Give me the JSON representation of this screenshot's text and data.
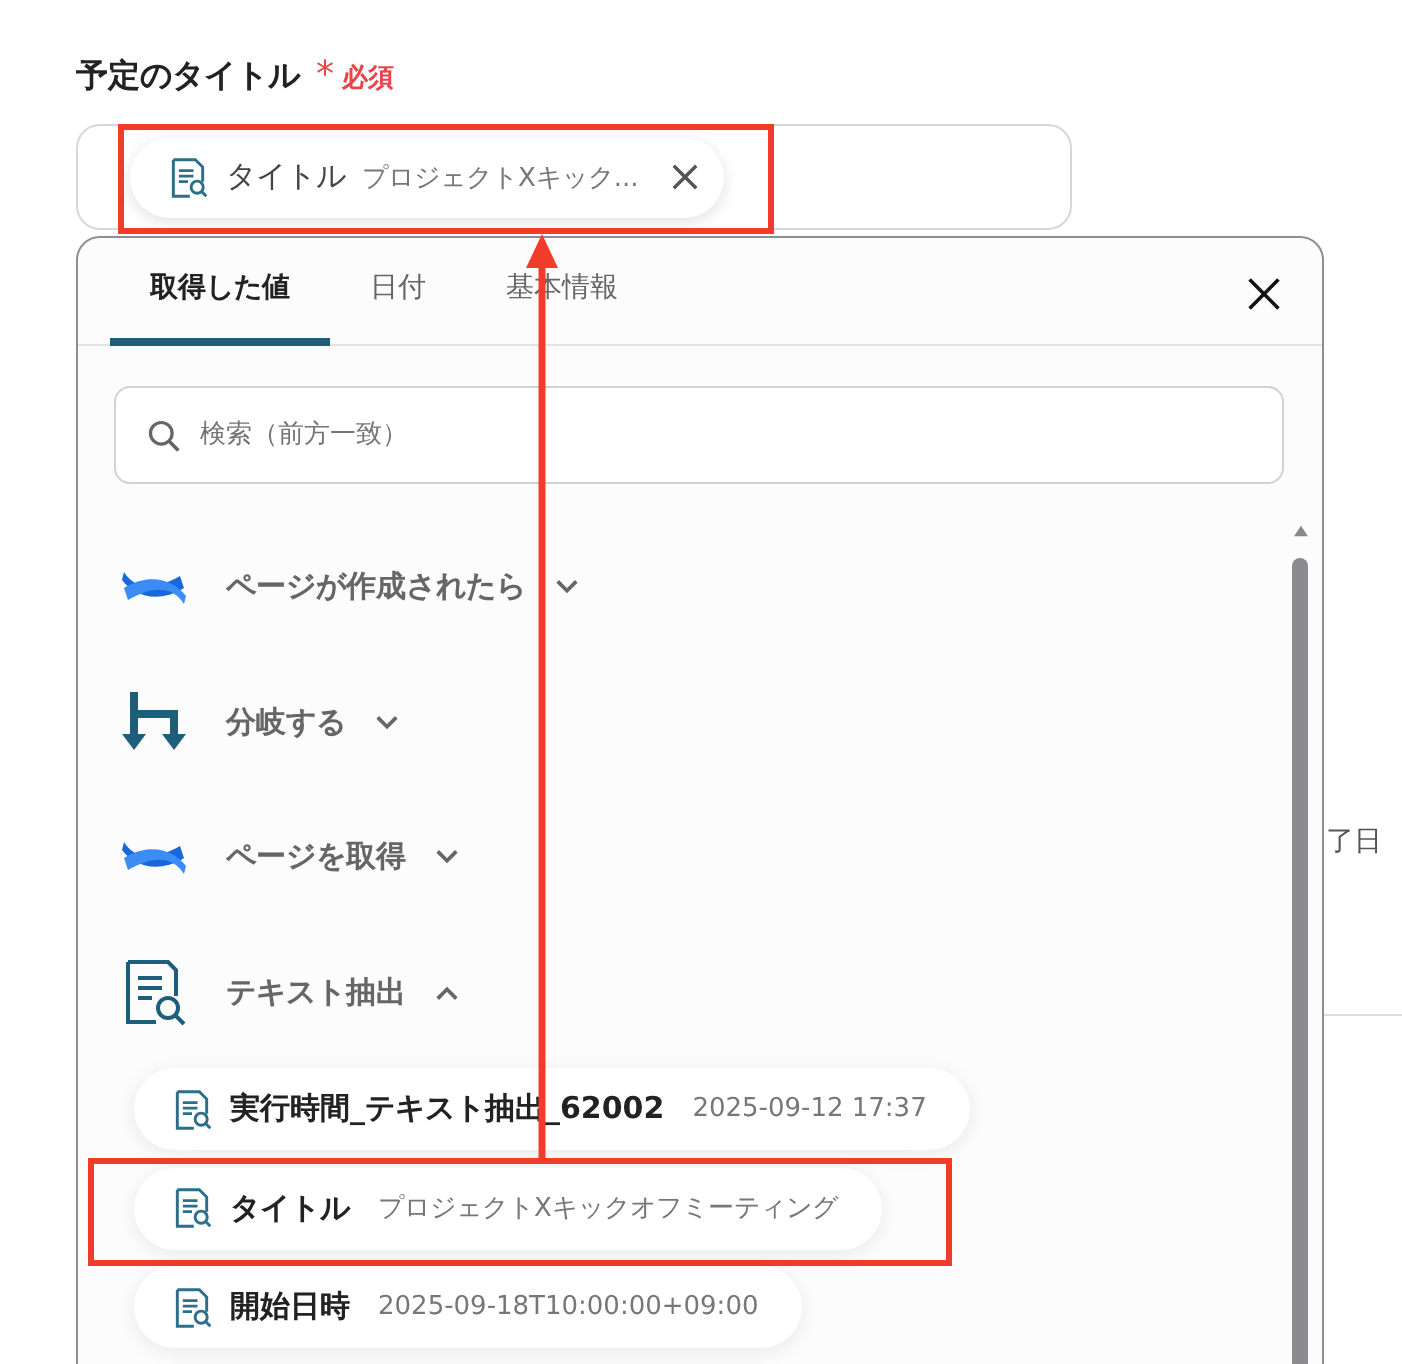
{
  "field": {
    "label": "予定のタイトル",
    "required_mark": "*",
    "required_text": "必須",
    "chip": {
      "name": "タイトル",
      "value": "プロジェクトXキック...",
      "highlighted": true
    }
  },
  "background_text": "了日",
  "popup": {
    "tabs": [
      {
        "label": "取得した値",
        "selected": true
      },
      {
        "label": "日付",
        "selected": false
      },
      {
        "label": "基本情報",
        "selected": false
      }
    ],
    "search": {
      "placeholder": "検索（前方一致）"
    },
    "groups": [
      {
        "kind": "page",
        "label": "ページが作成されたら",
        "expanded": false
      },
      {
        "kind": "branch",
        "label": "分岐する",
        "expanded": false
      },
      {
        "kind": "page",
        "label": "ページを取得",
        "expanded": false
      },
      {
        "kind": "text",
        "label": "テキスト抽出",
        "expanded": true,
        "items": [
          {
            "name": "実行時間_テキスト抽出_62002",
            "value": "2025-09-12 17:37",
            "highlighted": false
          },
          {
            "name": "タイトル",
            "value": "プロジェクトXキックオフミーティング",
            "highlighted": true
          },
          {
            "name": "開始日時",
            "value": "2025-09-18T10:00:00+09:00",
            "highlighted": false
          }
        ]
      }
    ]
  }
}
